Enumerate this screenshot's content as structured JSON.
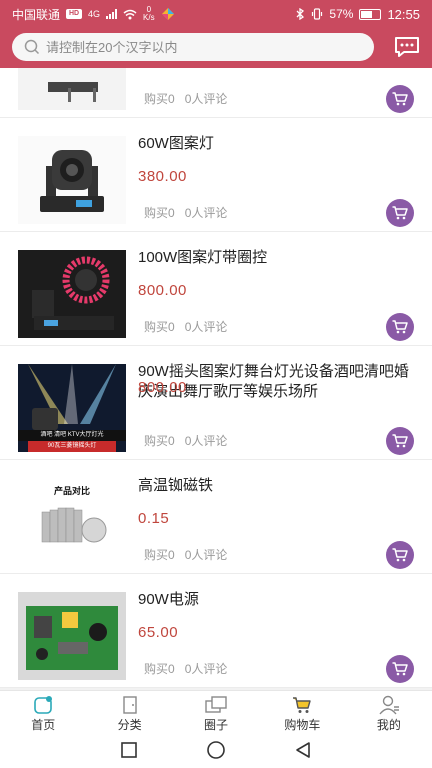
{
  "status_bar": {
    "carrier": "中国联通",
    "network_badge": "HD",
    "signal_type": "4G",
    "speed_value": "0",
    "speed_unit": "K/s",
    "battery_percent": "57%",
    "time": "12:55"
  },
  "search": {
    "placeholder": "请控制在20个汉字以内"
  },
  "products": [
    {
      "title": "",
      "price": "",
      "buys": "购买0",
      "comments": "0人评论"
    },
    {
      "title": "60W图案灯",
      "price": "380.00",
      "buys": "购买0",
      "comments": "0人评论"
    },
    {
      "title": "100W图案灯带圈控",
      "price": "800.00",
      "buys": "购买0",
      "comments": "0人评论"
    },
    {
      "title": "90W摇头图案灯舞台灯光设备酒吧清吧婚庆演出舞厅歌厅等娱乐场所",
      "price": "800.00",
      "buys": "购买0",
      "comments": "0人评论",
      "thumb_banner": "酒吧 清吧 KTV大厅灯光",
      "thumb_tag": "90瓦三菱镜摇头灯"
    },
    {
      "title": "高温铷磁铁",
      "price": "0.15",
      "buys": "购买0",
      "comments": "0人评论",
      "thumb_caption": "产品对比"
    },
    {
      "title": "90W电源",
      "price": "65.00",
      "buys": "购买0",
      "comments": "0人评论"
    }
  ],
  "tabs": [
    {
      "label": "首页",
      "icon": "home-icon"
    },
    {
      "label": "分类",
      "icon": "category-icon"
    },
    {
      "label": "圈子",
      "icon": "circle-icon"
    },
    {
      "label": "购物车",
      "icon": "cart-icon"
    },
    {
      "label": "我的",
      "icon": "user-icon"
    }
  ],
  "colors": {
    "header": "#c94a5f",
    "price": "#c0463d",
    "cart_button": "#8a5aa6",
    "active_tab": "#2aa9b8"
  }
}
